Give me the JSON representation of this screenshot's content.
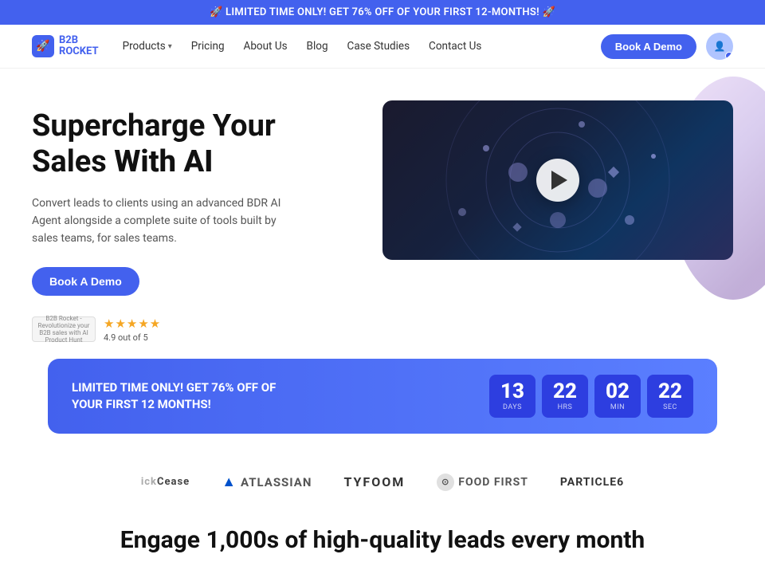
{
  "banner": {
    "text": "🚀 LIMITED TIME ONLY! GET 76% OFF OF YOUR FIRST 12-MONTHS! 🚀"
  },
  "navbar": {
    "logo": "B2B ROCKET",
    "logo_line1": "B2B",
    "logo_line2": "ROCKET",
    "nav_items": [
      {
        "label": "Products",
        "has_dropdown": true
      },
      {
        "label": "Pricing",
        "has_dropdown": false
      },
      {
        "label": "About Us",
        "has_dropdown": false
      },
      {
        "label": "Blog",
        "has_dropdown": false
      },
      {
        "label": "Case Studies",
        "has_dropdown": false
      },
      {
        "label": "Contact Us",
        "has_dropdown": false
      }
    ],
    "cta_button": "Book A Demo"
  },
  "hero": {
    "title_line1": "Supercharge Your",
    "title_line2": "Sales ",
    "title_bold": "With AI",
    "description": "Convert leads to clients using an advanced BDR AI Agent alongside a complete suite of tools built by sales teams, for sales teams.",
    "cta_button": "Book A Demo",
    "social_proof": {
      "badge_text": "B2B Rocket - Revolutionize your B2B sales with AI Product Hunt",
      "stars": "★★★★★",
      "rating": "4.9 out of 5"
    }
  },
  "countdown": {
    "label": "LIMITED TIME ONLY! GET 76% OFF OF YOUR FIRST 12 MONTHS!",
    "days": {
      "value": "13",
      "label": "DAYS"
    },
    "hrs": {
      "value": "22",
      "label": "HRS"
    },
    "min": {
      "value": "02",
      "label": "MIN"
    },
    "sec": {
      "value": "22",
      "label": "SEC"
    }
  },
  "logos": [
    {
      "key": "clickease",
      "text": "ickCease"
    },
    {
      "key": "atlassian",
      "text": "ATLASSIAN"
    },
    {
      "key": "tyfoom",
      "text": "TYFOOM"
    },
    {
      "key": "foodfirst",
      "text": "FOOD FIRST"
    },
    {
      "key": "particle",
      "text": "PARTICLE6"
    }
  ],
  "bottom": {
    "heading": "Engage 1,000s of high-quality leads every month"
  }
}
